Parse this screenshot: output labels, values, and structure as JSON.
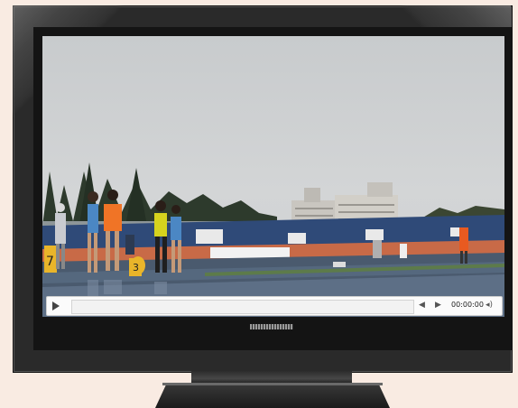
{
  "player": {
    "time_display": "00:00:00",
    "play_icon": "play-icon",
    "prev_icon": "previous-icon",
    "next_icon": "next-icon",
    "volume_icon": "volume-icon",
    "progress_fraction": 0
  },
  "scene": {
    "bib_numbers": [
      "7",
      "3"
    ]
  },
  "colors": {
    "background": "#f9ebe2",
    "bezel": "#2a2a2a",
    "track": "#4a5a6e",
    "seats": "#2f4a78"
  }
}
